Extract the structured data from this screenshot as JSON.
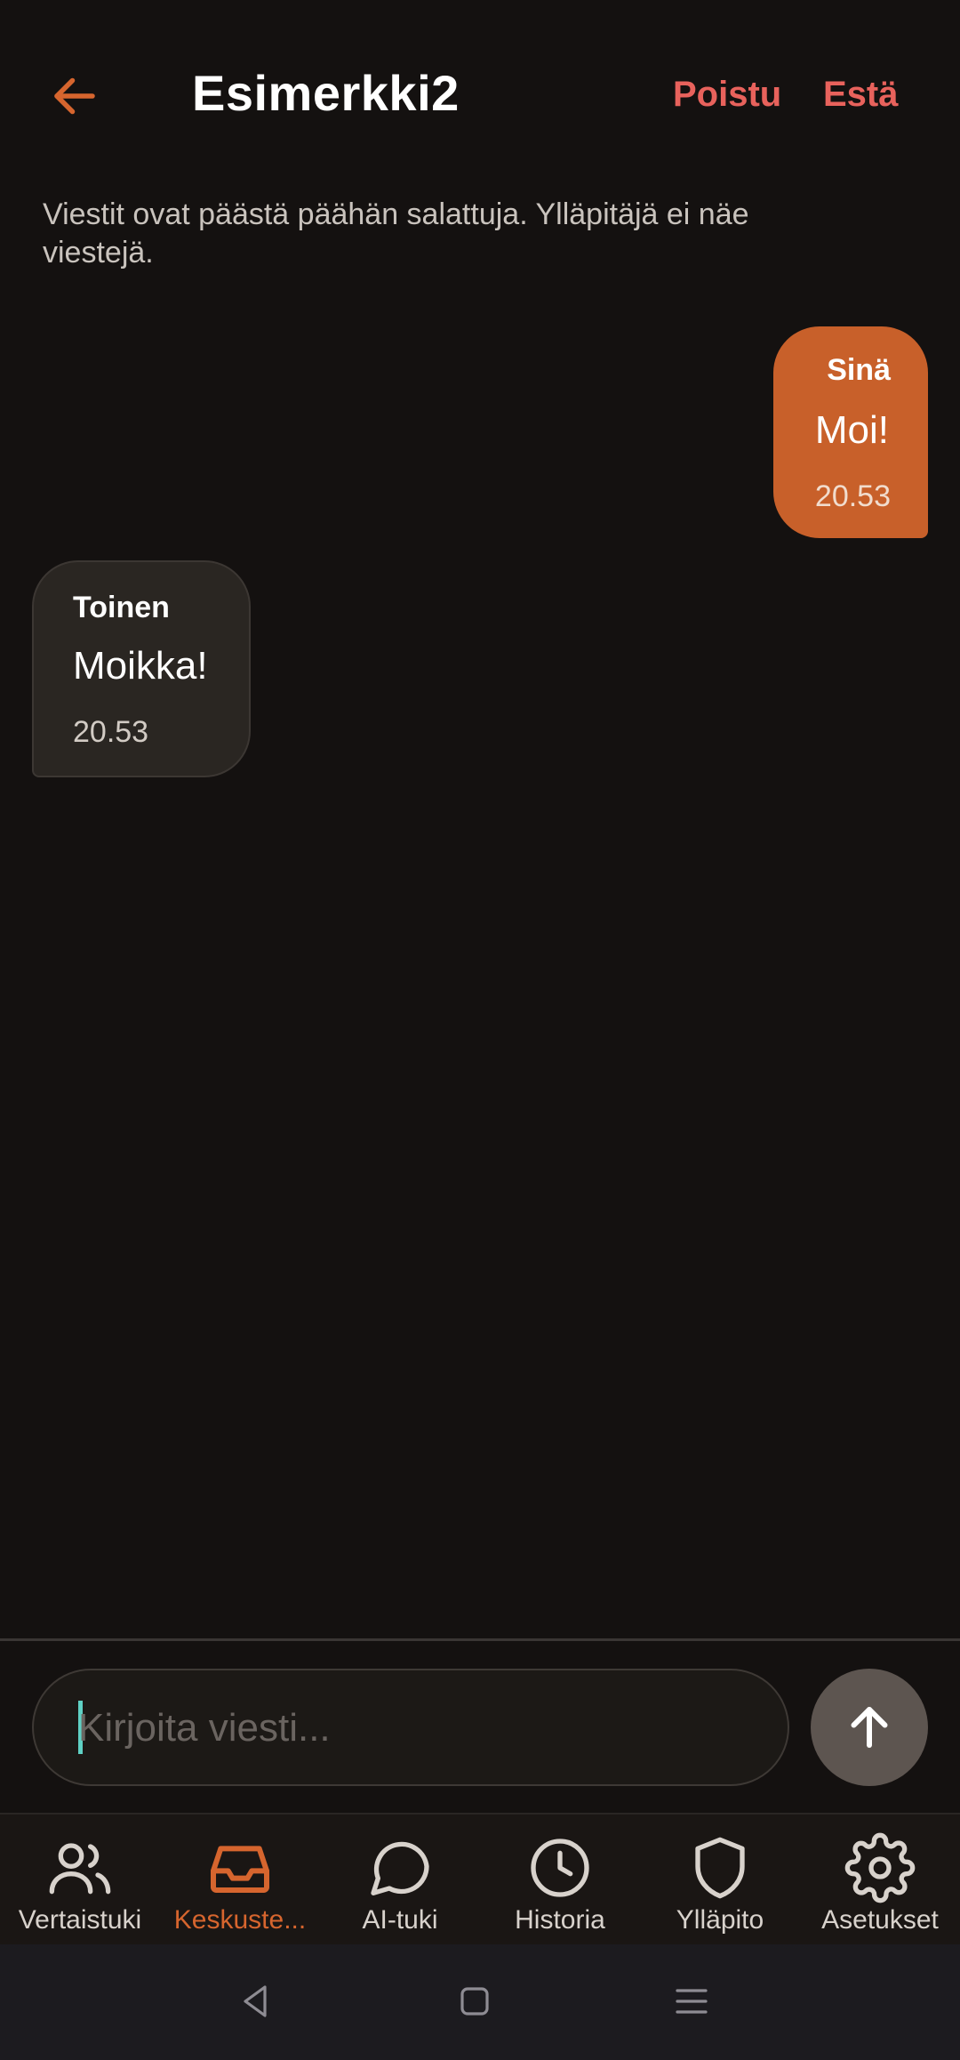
{
  "header": {
    "title": "Esimerkki2",
    "leave_label": "Poistu",
    "block_label": "Estä",
    "back_icon": "arrow-left-icon",
    "accent": "#d6652e",
    "action_color": "#e8625c"
  },
  "notice": "Viestit ovat päästä päähän salattuja. Ylläpitäjä ei näe viestejä.",
  "messages": [
    {
      "sender": "Sinä",
      "text": "Moi!",
      "time": "20.53",
      "own": true
    },
    {
      "sender": "Toinen",
      "text": "Moikka!",
      "time": "20.53",
      "own": false
    }
  ],
  "composer": {
    "placeholder": "Kirjoita viesti...",
    "value": "",
    "send_icon": "arrow-up-icon"
  },
  "nav": {
    "items": [
      {
        "label": "Vertaistuki",
        "icon": "users-icon",
        "active": false
      },
      {
        "label": "Keskuste...",
        "icon": "inbox-icon",
        "active": true
      },
      {
        "label": "AI-tuki",
        "icon": "chat-bubble-icon",
        "active": false
      },
      {
        "label": "Historia",
        "icon": "clock-icon",
        "active": false
      },
      {
        "label": "Ylläpito",
        "icon": "shield-icon",
        "active": false
      },
      {
        "label": "Asetukset",
        "icon": "gear-icon",
        "active": false
      }
    ]
  },
  "system_nav": {
    "back_icon": "system-back-icon",
    "home_icon": "system-home-icon",
    "recents_icon": "system-recents-icon"
  }
}
